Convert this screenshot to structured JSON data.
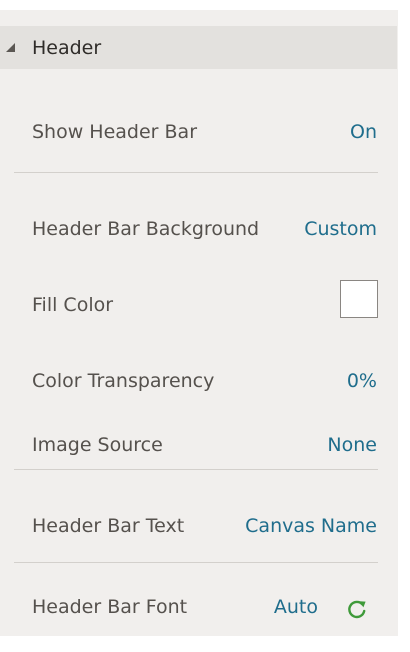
{
  "section": {
    "title": "Header"
  },
  "rows": {
    "show_header_bar": {
      "label": "Show Header Bar",
      "value": "On"
    },
    "header_bar_background": {
      "label": "Header Bar Background",
      "value": "Custom"
    },
    "fill_color": {
      "label": "Fill Color",
      "swatch_color": "#ffffff"
    },
    "color_transparency": {
      "label": "Color Transparency",
      "value": "0%"
    },
    "image_source": {
      "label": "Image Source",
      "value": "None"
    },
    "header_bar_text": {
      "label": "Header Bar Text",
      "value": "Canvas Name"
    },
    "header_bar_font": {
      "label": "Header Bar Font",
      "value": "Auto",
      "icon": "refresh-icon"
    }
  },
  "colors": {
    "accent": "#1f6d8c",
    "reset_icon": "#3f9a3a",
    "panel_bg": "#f1efed",
    "header_bg": "#e3e1de"
  }
}
